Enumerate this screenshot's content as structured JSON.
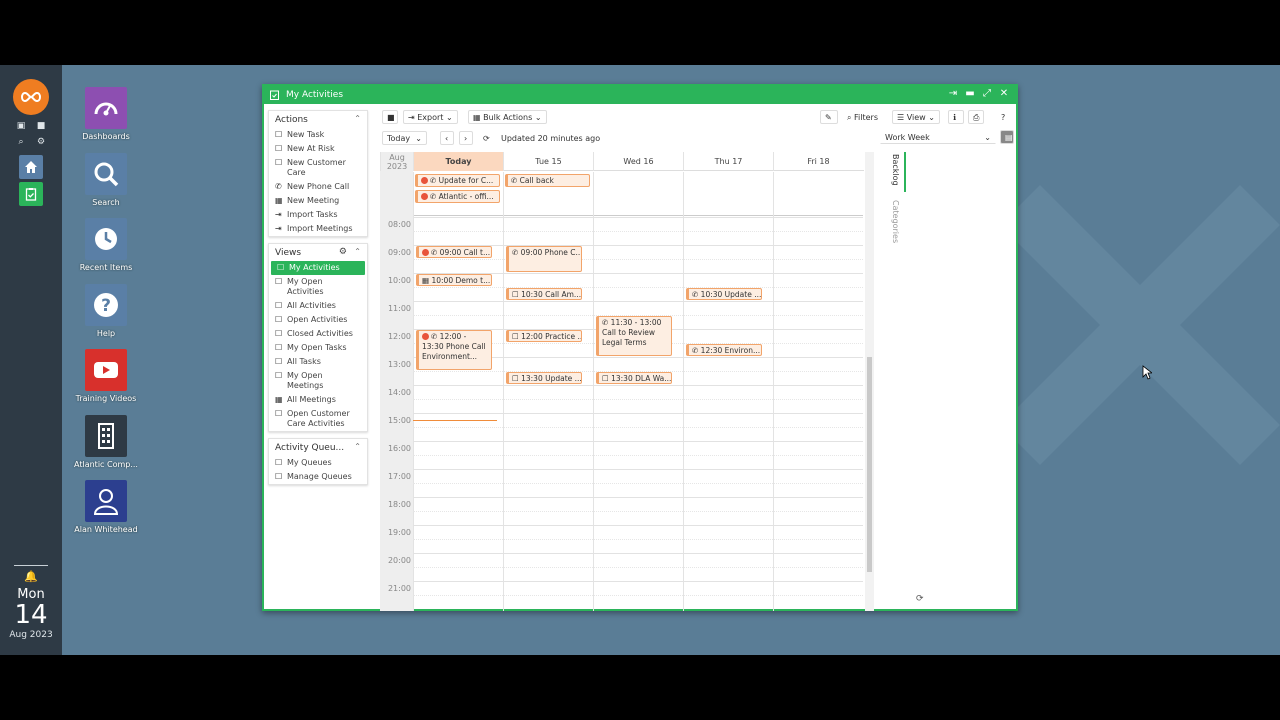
{
  "taskbar": {
    "clock": {
      "day_of_week": "Mon",
      "day": "14",
      "month_year": "Aug 2023"
    }
  },
  "desktop_icons": [
    {
      "label": "Dashboards",
      "color": "#8d4fb1",
      "icon": "gauge-icon"
    },
    {
      "label": "Search",
      "color": "#5a7fa6",
      "icon": "search-icon"
    },
    {
      "label": "Recent Items",
      "color": "#5a7fa6",
      "icon": "clock-icon"
    },
    {
      "label": "Help",
      "color": "#5a7fa6",
      "icon": "help-icon"
    },
    {
      "label": "Training Videos",
      "color": "#d8302c",
      "icon": "play-icon"
    },
    {
      "label": "Atlantic Comp...",
      "color": "#2e3a45",
      "icon": "building-icon"
    },
    {
      "label": "Alan Whitehead",
      "color": "#2c3f8f",
      "icon": "user-icon"
    }
  ],
  "window": {
    "title": "My Activities",
    "accent": "#2bb45a"
  },
  "actions_panel": {
    "title": "Actions",
    "items": [
      {
        "label": "New Task",
        "icon": "check-icon"
      },
      {
        "label": "New At Risk",
        "icon": "check-icon"
      },
      {
        "label": "New Customer Care",
        "icon": "check-icon"
      },
      {
        "label": "New Phone Call",
        "icon": "phone-icon"
      },
      {
        "label": "New Meeting",
        "icon": "calendar-icon"
      },
      {
        "label": "Import Tasks",
        "icon": "import-icon"
      },
      {
        "label": "Import Meetings",
        "icon": "import-icon"
      }
    ]
  },
  "views_panel": {
    "title": "Views",
    "items": [
      {
        "label": "My Activities",
        "active": true
      },
      {
        "label": "My Open Activities"
      },
      {
        "label": "All Activities"
      },
      {
        "label": "Open Activities"
      },
      {
        "label": "Closed Activities"
      },
      {
        "label": "My Open Tasks"
      },
      {
        "label": "All Tasks"
      },
      {
        "label": "My Open Meetings"
      },
      {
        "label": "All Meetings"
      },
      {
        "label": "Open Customer Care Activities"
      }
    ]
  },
  "queues_panel": {
    "title": "Activity Queu...",
    "items": [
      {
        "label": "My Queues"
      },
      {
        "label": "Manage Queues"
      }
    ]
  },
  "toolbar": {
    "export_label": "Export",
    "bulk_label": "Bulk Actions",
    "filters_label": "Filters",
    "view_label": "View"
  },
  "nav": {
    "today_label": "Today",
    "updated": "Updated 20 minutes ago",
    "view_mode": "Work Week"
  },
  "calendar": {
    "corner": "Aug 2023",
    "days": [
      "Today",
      "Tue 15",
      "Wed 16",
      "Thu 17",
      "Fri 18"
    ],
    "hours": [
      "08:00",
      "09:00",
      "10:00",
      "11:00",
      "12:00",
      "13:00",
      "14:00",
      "15:00",
      "16:00",
      "17:00",
      "18:00",
      "19:00",
      "20:00",
      "21:00"
    ],
    "allday_events": [
      {
        "day": 0,
        "row": 0,
        "text": "Update for C...",
        "alert": true
      },
      {
        "day": 1,
        "row": 0,
        "text": "Call back",
        "alert": false
      },
      {
        "day": 0,
        "row": 1,
        "text": "Atlantic - offi...",
        "alert": true
      }
    ],
    "events": [
      {
        "day": 0,
        "start": 9.0,
        "end": 9.5,
        "text": "09:00 Call t...",
        "alert": true,
        "icon": "phone"
      },
      {
        "day": 1,
        "start": 9.0,
        "end": 10.0,
        "text": "09:00 Phone C...",
        "alert": false,
        "icon": "phone"
      },
      {
        "day": 0,
        "start": 10.0,
        "end": 10.5,
        "text": "10:00 Demo t...",
        "alert": false,
        "icon": "meeting"
      },
      {
        "day": 1,
        "start": 10.5,
        "end": 11.0,
        "text": "10:30 Call Am...",
        "alert": false,
        "icon": "task"
      },
      {
        "day": 3,
        "start": 10.5,
        "end": 11.0,
        "text": "10:30 Update ...",
        "alert": false,
        "icon": "phone"
      },
      {
        "day": 2,
        "start": 11.5,
        "end": 13.0,
        "text": "11:30 - 13:00 Call to Review Legal Terms",
        "alert": false,
        "icon": "phone",
        "tall": true
      },
      {
        "day": 0,
        "start": 12.0,
        "end": 13.5,
        "text": "12:00 - 13:30 Phone Call Environment...",
        "alert": true,
        "icon": "phone",
        "tall": true
      },
      {
        "day": 1,
        "start": 12.0,
        "end": 12.5,
        "text": "12:00 Practice ...",
        "alert": false,
        "icon": "task"
      },
      {
        "day": 3,
        "start": 12.5,
        "end": 13.0,
        "text": "12:30 Environ...",
        "alert": false,
        "icon": "phone"
      },
      {
        "day": 1,
        "start": 13.5,
        "end": 14.0,
        "text": "13:30 Update ...",
        "alert": false,
        "icon": "task"
      },
      {
        "day": 2,
        "start": 13.5,
        "end": 14.0,
        "text": "13:30 DLA Wa...",
        "alert": false,
        "icon": "task"
      }
    ],
    "now_hour": 15.25
  },
  "right_panel": {
    "tab_active": "Backlog",
    "tab_inactive": "Categories"
  }
}
